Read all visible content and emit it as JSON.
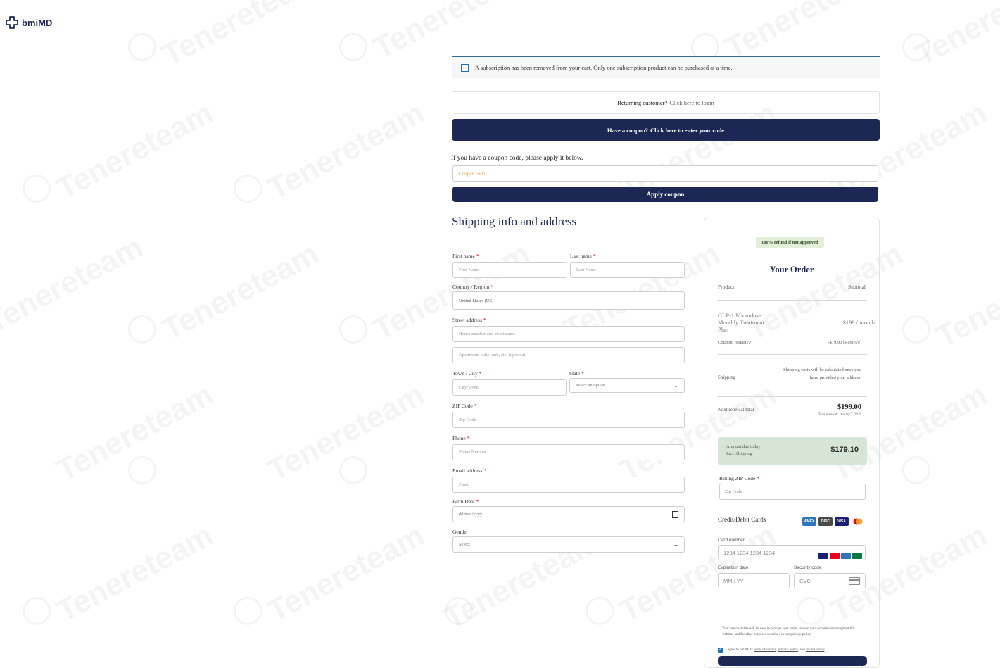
{
  "brand": {
    "name": "bmiMD",
    "color": "#1c2755"
  },
  "watermark": {
    "text": "Tenereteam"
  },
  "notice": {
    "text": "A subscription has been removed from your cart. Only one subscription product can be purchased at a time.",
    "icon": "calendar-icon"
  },
  "returning": {
    "prompt": "Returning customer?",
    "link": "Click here to login"
  },
  "coupon": {
    "bar_text": "Have a coupon?",
    "bar_link": "Click here to enter your code",
    "intro": "If you have a coupon code, please apply it below.",
    "placeholder": "Coupon code",
    "apply_label": "Apply coupon"
  },
  "shipping": {
    "title": "Shipping info and address",
    "required_mark": "*",
    "first_name": {
      "label": "First name",
      "placeholder": "First Name"
    },
    "last_name": {
      "label": "Last name",
      "placeholder": "Last Name"
    },
    "country": {
      "label": "Country / Region",
      "value": "United States (US)"
    },
    "street": {
      "label": "Street address",
      "placeholder1": "House number and street name",
      "placeholder2": "Apartment, suite, unit, etc. (optional)"
    },
    "town": {
      "label": "Town / City",
      "placeholder": "City/Town"
    },
    "state": {
      "label": "State",
      "value": "Select an option…"
    },
    "zip": {
      "label": "ZIP Code",
      "placeholder": "Zip Code"
    },
    "phone": {
      "label": "Phone",
      "placeholder": "Phone Number"
    },
    "email": {
      "label": "Email address",
      "placeholder": "Email"
    },
    "birth": {
      "label": "Birth Date",
      "placeholder": "dd/mm/yyyy"
    },
    "gender": {
      "label": "Gender",
      "value": "Select"
    }
  },
  "order": {
    "refund_badge": "100% refund if not approved",
    "title": "Your Order",
    "col_product": "Product",
    "col_subtotal": "Subtotal",
    "item_name": "GLP-1 Microdose Monthly Treatment Plan",
    "item_price": "$199",
    "item_period": "/ month",
    "coupon_label": "Coupon: restart10",
    "coupon_amount": "-$19.90",
    "coupon_remove": "[Remove]",
    "shipping_label": "Shipping",
    "shipping_text": "Shipping costs will be calculated once you have provided your address.",
    "renewal_label": "Next renewal total",
    "renewal_amount": "$199.00",
    "renewal_date": "First renewal: January 7, 2026",
    "due_label1": "Amount due today",
    "due_label2": "Incl. Shipping",
    "due_amount": "$179.10",
    "billing_zip_label": "Billing ZIP Code",
    "billing_zip_placeholder": "Zip Code",
    "cards_label": "Credit/Debit Cards",
    "card_number_label": "Card number",
    "card_number_placeholder": "1234 1234 1234 1234",
    "expiry_label": "Expiration date",
    "expiry_placeholder": "MM / YY",
    "cvc_label": "Security code",
    "cvc_placeholder": "CVC",
    "legal_text": "Your personal data will be used to process your order, support your experience throughout this website, and for other purposes described in our",
    "legal_link": "privacy policy",
    "agree_text": "I agree to bmiMD's",
    "agree_terms": "terms of service",
    "agree_privacy": "privacy policy",
    "agree_and": ", and",
    "agree_refund": "refund policy",
    "card_brands": [
      "AMEX",
      "DISC",
      "VISA",
      "MC"
    ],
    "mini_brands": [
      "VISA",
      "MC",
      "AMEX",
      "JCB"
    ]
  }
}
